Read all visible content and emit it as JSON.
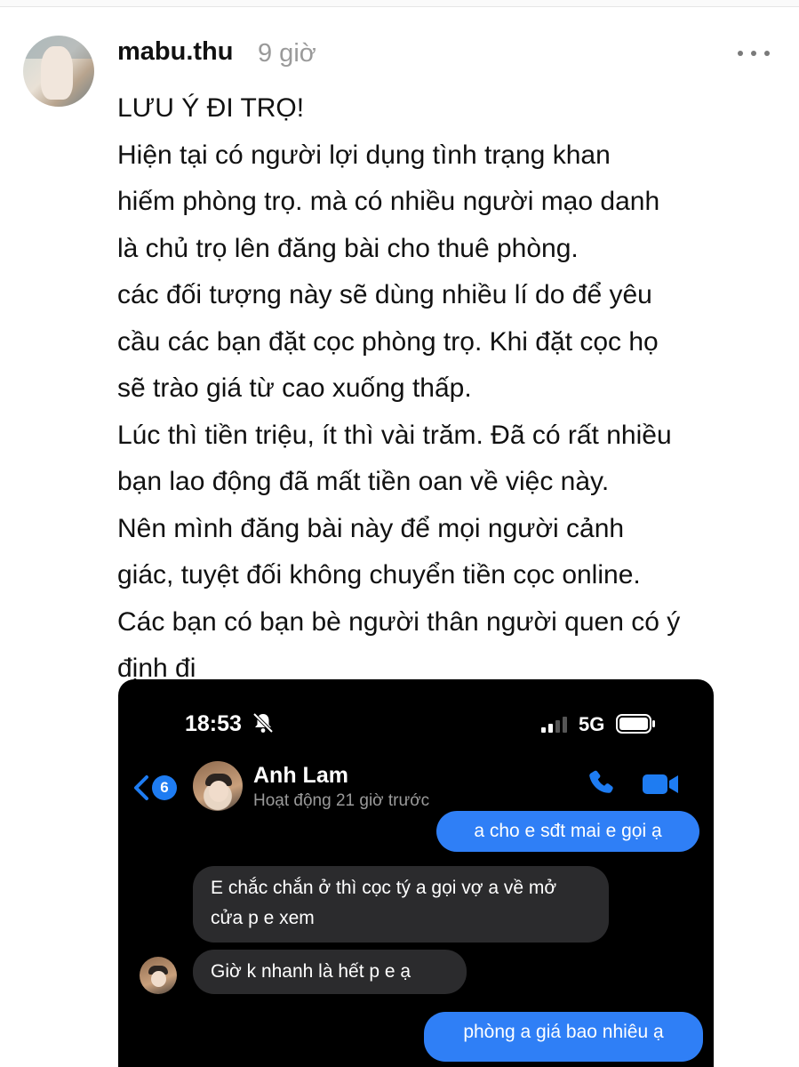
{
  "post": {
    "username": "mabu.thu",
    "timestamp": "9 giờ",
    "more_icon": "more-horizontal-icon",
    "lines": [
      "LƯU Ý ĐI TRỌ!",
      "Hiện tại có người lợi dụng tình trạng khan",
      "hiếm phòng trọ. mà có nhiều người mạo danh",
      "là chủ trọ lên đăng bài cho thuê phòng.",
      "các đối tượng này sẽ dùng nhiều lí do để yêu",
      "cầu các bạn đặt cọc phòng trọ. Khi đặt cọc họ",
      "sẽ trào giá từ cao xuống thấp.",
      "Lúc thì tiền triệu, ít thì vài trăm. Đã có rất nhiều",
      "bạn lao động đã mất tiền oan về việc này.",
      "Nên mình đăng bài này để mọi người cảnh",
      "giác, tuyệt đối không chuyển tiền cọc online.",
      "Các bạn có bạn bè người thân người quen có ý",
      "định đi"
    ]
  },
  "screenshot": {
    "status_bar": {
      "time": "18:53",
      "network": "5G",
      "icons": [
        "bell-slash-icon",
        "signal-icon",
        "battery-icon"
      ]
    },
    "header": {
      "back_badge": "6",
      "contact_name": "Anh Lam",
      "contact_status": "Hoạt động 21 giờ trước",
      "icons": [
        "back-chevron-icon",
        "phone-icon",
        "video-camera-icon"
      ]
    },
    "messages": [
      {
        "direction": "out",
        "text": "a cho e sđt mai e gọi ạ"
      },
      {
        "direction": "in",
        "text": "E chắc chắn ở thì cọc tý a gọi vợ a về mở cửa p e xem"
      },
      {
        "direction": "in",
        "text": "Giờ k nhanh là hết p e ạ"
      },
      {
        "direction": "out",
        "text": "phòng a giá bao nhiêu ạ"
      }
    ],
    "colors": {
      "background": "#000000",
      "outgoing_bubble": "#2f7ff6",
      "incoming_bubble": "#2b2b2d",
      "accent": "#1e7cf2"
    }
  }
}
